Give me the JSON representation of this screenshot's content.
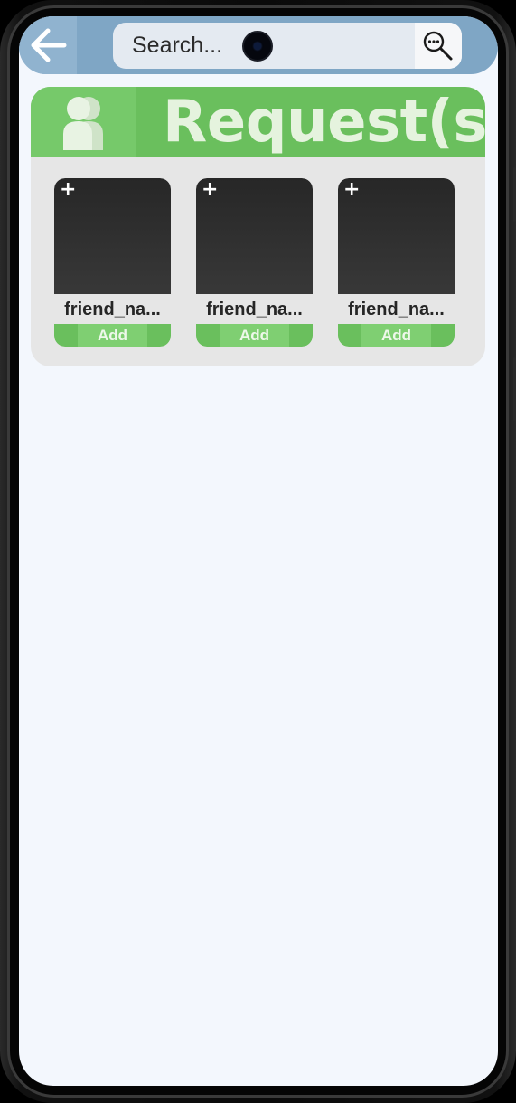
{
  "search": {
    "placeholder": "Search..."
  },
  "requests": {
    "title": "Request(s)",
    "friends": [
      {
        "name": "friend_na...",
        "add_label": "Add"
      },
      {
        "name": "friend_na...",
        "add_label": "Add"
      },
      {
        "name": "friend_na...",
        "add_label": "Add"
      }
    ]
  },
  "icons": {
    "back": "arrow-left-icon",
    "search": "search-more-icon",
    "header": "users-icon",
    "card_plus": "plus-icon"
  },
  "colors": {
    "topbar": "#7fa6c5",
    "accent_green": "#6abf5d",
    "screen_bg": "#f3f7fd",
    "card_bg": "#e6e6e6"
  }
}
